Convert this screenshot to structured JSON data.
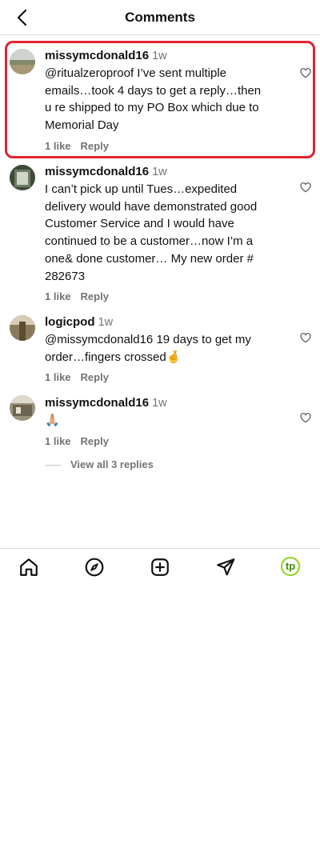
{
  "header": {
    "title": "Comments",
    "back_icon": "chevron-left-icon"
  },
  "comments": [
    {
      "username": "missymcdonald16",
      "time": "1w",
      "text": "@ritualzeroproof I’ve sent multiple emails…took 4 days to get a reply…then u re shipped to my PO Box which due to Memorial Day",
      "likes": "1 like",
      "reply": "Reply",
      "highlighted": true
    },
    {
      "username": "missymcdonald16",
      "time": "1w",
      "text": "I can’t pick up until Tues…expedited delivery would have demonstrated good Customer Service and I would have continued to be a customer…now I’m a one& done customer… My new order # 282673",
      "likes": "1 like",
      "reply": "Reply"
    },
    {
      "username": "logicpod",
      "time": "1w",
      "text": "@missymcdonald16 19 days to get my order…fingers crossed🤞",
      "likes": "1 like",
      "reply": "Reply"
    },
    {
      "username": "missymcdonald16",
      "time": "1w",
      "text": "🙏🏼",
      "likes": "1 like",
      "reply": "Reply"
    }
  ],
  "view_replies": "View all 3 replies",
  "tabbar": {
    "items": [
      "home-icon",
      "explore-compass-icon",
      "new-post-plus-icon",
      "direct-message-icon",
      "profile-avatar"
    ],
    "profile_initials": "tp",
    "profile_ring_color": "#8fd11c"
  },
  "colors": {
    "highlight_border": "#e0242e",
    "secondary_text": "#737373"
  }
}
